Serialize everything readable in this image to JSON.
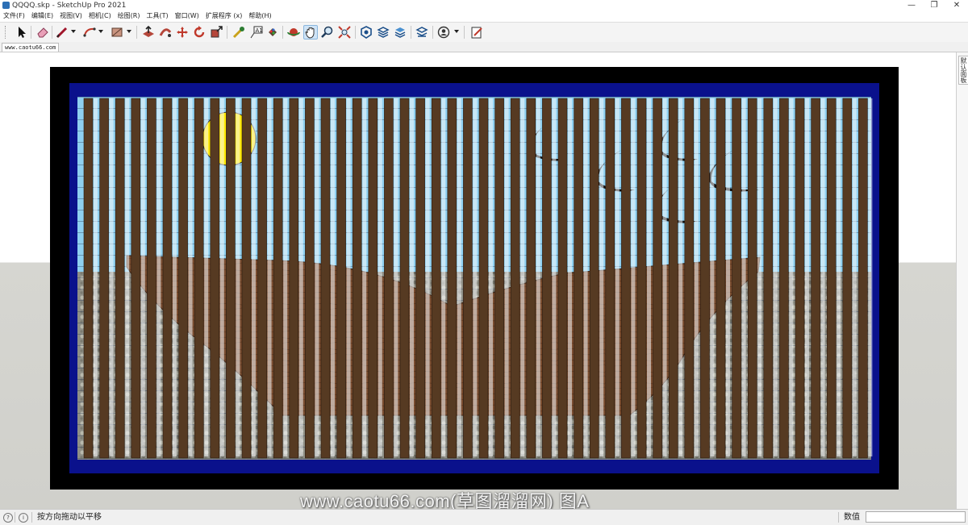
{
  "window": {
    "title": "QQQQ.skp - SketchUp Pro 2021",
    "buttons": [
      "—",
      "❐",
      "✕"
    ]
  },
  "menubar": [
    "文件(F)",
    "编辑(E)",
    "视图(V)",
    "相机(C)",
    "绘图(R)",
    "工具(T)",
    "窗口(W)",
    "扩展程序 (x)",
    "帮助(H)"
  ],
  "toolbar": {
    "active_tool": "orbit"
  },
  "scene_tab": "www.caotu66.com",
  "viewport": {
    "watermark": "www.caotu66.com(草图溜溜网) 图A",
    "colors": {
      "frame": "#000000",
      "border": "#0a118c",
      "sky": "#8fd0f0",
      "sun": "#ffe800",
      "slat": "#563a22",
      "boat": "#7a4d30",
      "stone": "#8f8f86",
      "bird": "#111111"
    }
  },
  "right_tray": {
    "tab_label": "默认面板"
  },
  "statusbar": {
    "hint": "按方向拖动以平移",
    "measure_label": "数值",
    "measure_value": ""
  }
}
